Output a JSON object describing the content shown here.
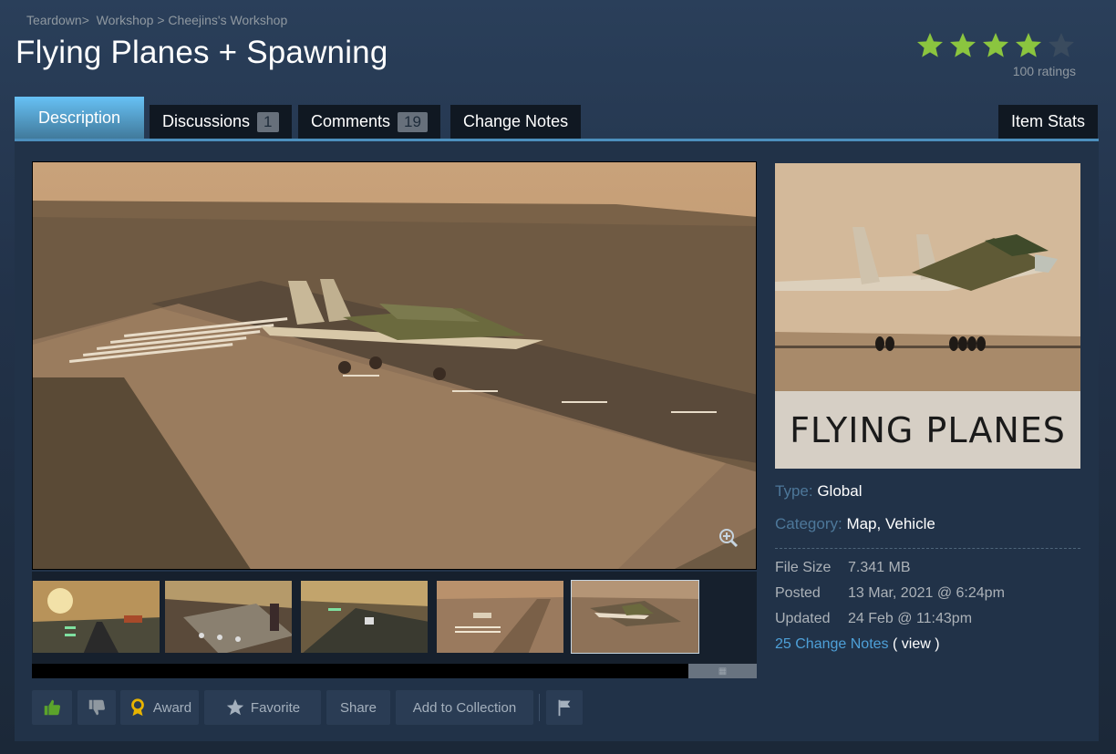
{
  "breadcrumb": {
    "game": "Teardown",
    "sep1": ">",
    "workshop": "Workshop",
    "sep2": ">",
    "author_workshop": "Cheejins's Workshop"
  },
  "title": "Flying Planes + Spawning",
  "rating": {
    "stars_filled": 4,
    "stars_total": 5,
    "count_label": "100 ratings",
    "star_color": "#8bc53f",
    "empty_star_color": "#3a4b5e"
  },
  "tabs": [
    {
      "label": "Description",
      "active": true
    },
    {
      "label": "Discussions",
      "count": "1"
    },
    {
      "label": "Comments",
      "count": "19"
    },
    {
      "label": "Change Notes"
    },
    {
      "label": "Item Stats"
    }
  ],
  "preview": {
    "banner_text": "FLYING PLANES"
  },
  "meta": {
    "type_label": "Type:",
    "type_value": "Global",
    "category_label": "Category:",
    "category_values": [
      "Map",
      "Vehicle"
    ],
    "category_sep": ",",
    "file_size_label": "File Size",
    "file_size": "7.341 MB",
    "posted_label": "Posted",
    "posted": "13 Mar, 2021 @ 6:24pm",
    "updated_label": "Updated",
    "updated": "24 Feb @ 11:43pm",
    "change_notes_link": "25 Change Notes",
    "view_link": "( view )"
  },
  "actions": {
    "thumbs_up": "thumbs-up-icon",
    "thumbs_down": "thumbs-down-icon",
    "award_label": "Award",
    "favorite_label": "Favorite",
    "share_label": "Share",
    "add_collection_label": "Add to Collection",
    "flag": "flag-icon"
  },
  "colors": {
    "accent": "#67c1f5",
    "background": "#1b2838",
    "panel": "#213248",
    "thumbs_up_green": "#5ba32b"
  }
}
